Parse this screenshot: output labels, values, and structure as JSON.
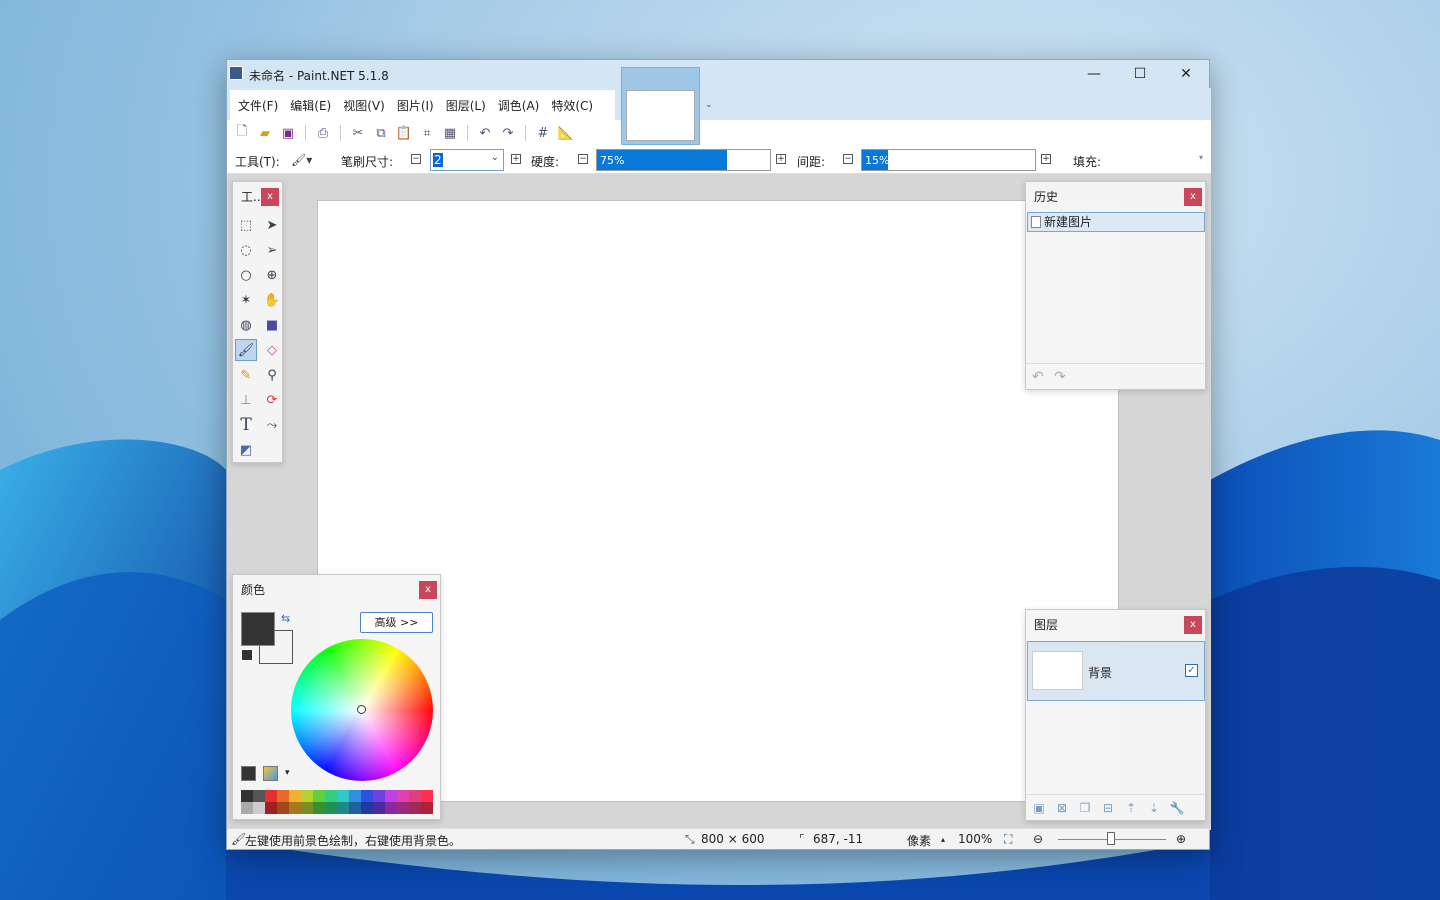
{
  "window": {
    "title": "未命名 - Paint.NET 5.1.8"
  },
  "titlebar": {
    "minimize": "—",
    "maximize": "☐",
    "close": "✕"
  },
  "menu": [
    "文件(F)",
    "编辑(E)",
    "视图(V)",
    "图片(I)",
    "图层(L)",
    "调色(A)",
    "特效(C)"
  ],
  "options": {
    "tool_label": "工具(T):",
    "brush_size_label": "笔刷尺寸:",
    "brush_size_value": "2",
    "hardness_label": "硬度:",
    "hardness_value": "75%",
    "hardness_fraction": 0.75,
    "spacing_label": "间距:",
    "spacing_value": "15%",
    "spacing_fraction": 0.15,
    "fill_label": "填充:"
  },
  "tools_panel": {
    "title": "工..."
  },
  "history_panel": {
    "title": "历史",
    "items": [
      "新建图片"
    ]
  },
  "layers_panel": {
    "title": "图层",
    "layers": [
      {
        "name": "背景",
        "visible": true
      }
    ]
  },
  "colors_panel": {
    "title": "颜色",
    "advanced_button": "高级 >>",
    "primary_color": "#333333",
    "secondary_color": "#f4f4f4"
  },
  "status": {
    "hint": "左键使用前景色绘制，右键使用背景色。",
    "image_size": "800 × 600",
    "cursor_pos": "687, -11",
    "units": "像素",
    "zoom": "100%"
  },
  "palette_colors": [
    "#333333",
    "#555555",
    "#e53030",
    "#e86a2a",
    "#f0b030",
    "#b8d030",
    "#60d040",
    "#30d080",
    "#30c8c8",
    "#3090e0",
    "#3050e0",
    "#7040e0",
    "#c040e0",
    "#e040b0",
    "#e0407a",
    "#ff3050",
    "#aaaaaa",
    "#cccccc",
    "#a02020",
    "#a04818",
    "#a87820",
    "#7a9020",
    "#3a9030",
    "#209058",
    "#208888",
    "#205fa0",
    "#203aa0",
    "#4a2aa0",
    "#8a2aa0",
    "#a02a7a",
    "#a02a55",
    "#b02038"
  ]
}
